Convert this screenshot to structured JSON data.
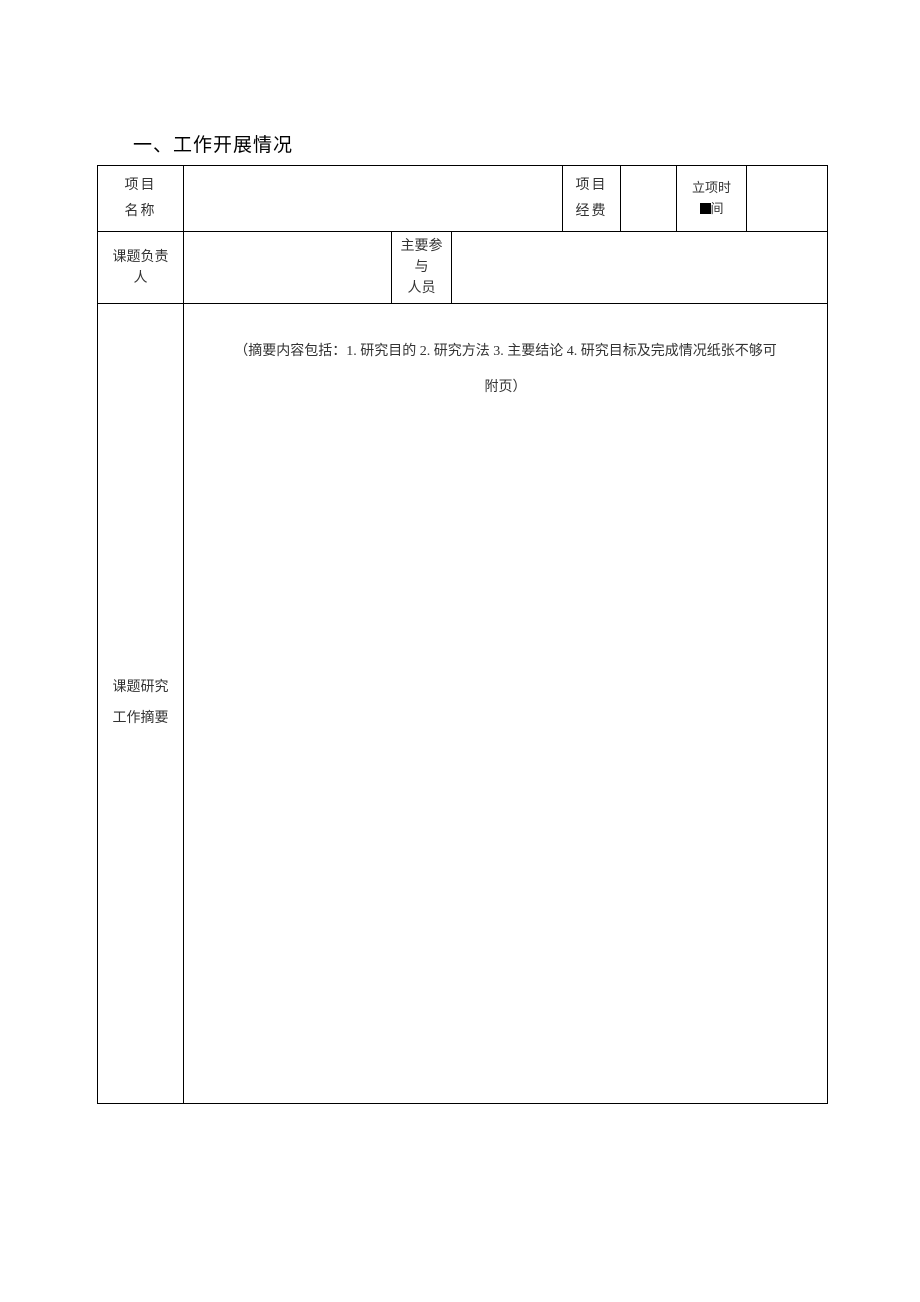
{
  "section_title": "一、工作开展情况",
  "row1": {
    "label1_line1": "项目",
    "label1_line2": "名称",
    "value1": "",
    "label3_line1": "项目",
    "label3_line2": "经费",
    "value3": "",
    "label4_line1": "立项时",
    "label4_line2_after_box": "间",
    "value4": ""
  },
  "row2": {
    "label1_line1": "课题负责",
    "label1_line2": "人",
    "value1": "",
    "label2_line1": "主要参与",
    "label2_line2": "人员",
    "value2": ""
  },
  "abstract": {
    "label_line1": "课题研究",
    "label_line2": "工作摘要",
    "note_line1": "（摘要内容包括：1. 研究目的 2. 研究方法 3. 主要结论 4. 研究目标及完成情况纸张不够可",
    "note_line2": "附页）"
  }
}
